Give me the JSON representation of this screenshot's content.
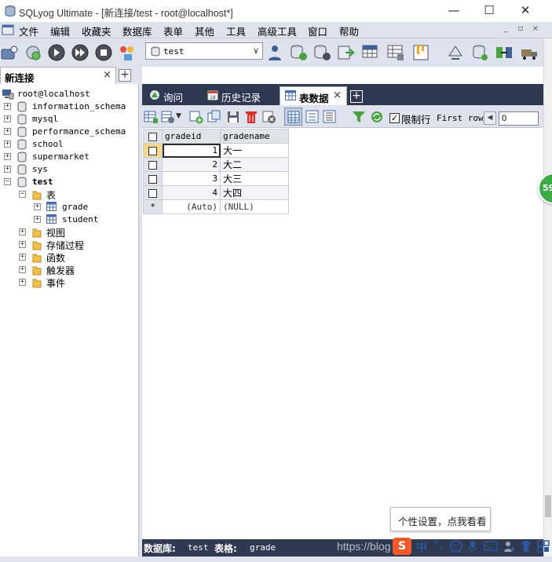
{
  "window": {
    "title": "SQLyog Ultimate - [新连接/test - root@localhost*]",
    "controls": [
      "—",
      "☐",
      "✕"
    ]
  },
  "menu": {
    "items": [
      "文件",
      "编辑",
      "收藏夹",
      "数据库",
      "表单",
      "其他",
      "工具",
      "高级工具",
      "窗口",
      "帮助"
    ],
    "mdi_controls": [
      "_",
      "▫",
      "×"
    ]
  },
  "toolbar": {
    "database_selector": "test"
  },
  "connection_tab": {
    "label": "新连接",
    "close": "×",
    "add": "+"
  },
  "tree": {
    "root": "root@localhost",
    "databases": [
      "information_schema",
      "mysql",
      "performance_schema",
      "school",
      "supermarket",
      "sys",
      "test"
    ],
    "test_children": {
      "tables_folder": "表",
      "tables": [
        "grade",
        "student"
      ],
      "folders": [
        "视图",
        "存储过程",
        "函数",
        "触发器",
        "事件"
      ]
    }
  },
  "query_tabs": {
    "tabs": [
      {
        "label": "询问"
      },
      {
        "label": "历史记录"
      },
      {
        "label": "表数据",
        "active": true
      }
    ],
    "close": "×",
    "add": "+"
  },
  "grid_toolbar": {
    "limit_rows_label": "限制行",
    "limit_rows_checked": "✓",
    "first_row_label": "First row",
    "first_row_value": "0",
    "prev_label": "◀"
  },
  "grid": {
    "columns": [
      "gradeid",
      "gradename"
    ],
    "rows": [
      {
        "gradeid": "1",
        "gradename": "大一"
      },
      {
        "gradeid": "2",
        "gradename": "大二"
      },
      {
        "gradeid": "3",
        "gradename": "大三"
      },
      {
        "gradeid": "4",
        "gradename": "大四"
      }
    ],
    "new_row": {
      "marker": "*",
      "gradeid": "(Auto)",
      "gradename": "(NULL)"
    }
  },
  "status": {
    "database_label": "数据库:",
    "database_value": "test",
    "table_label": "表格:",
    "table_value": "grade"
  },
  "overlays": {
    "watermark": "https://blog",
    "ime_tooltip": "个性设置，点我看看",
    "ime_chars": [
      "S",
      "中",
      "°,"
    ],
    "badge": "59"
  },
  "colors": {
    "chrome": "#dde2ec",
    "dark_bar": "#2f3a52",
    "selected_row_header": "#f5d98a",
    "badge_green": "#3caa46"
  }
}
